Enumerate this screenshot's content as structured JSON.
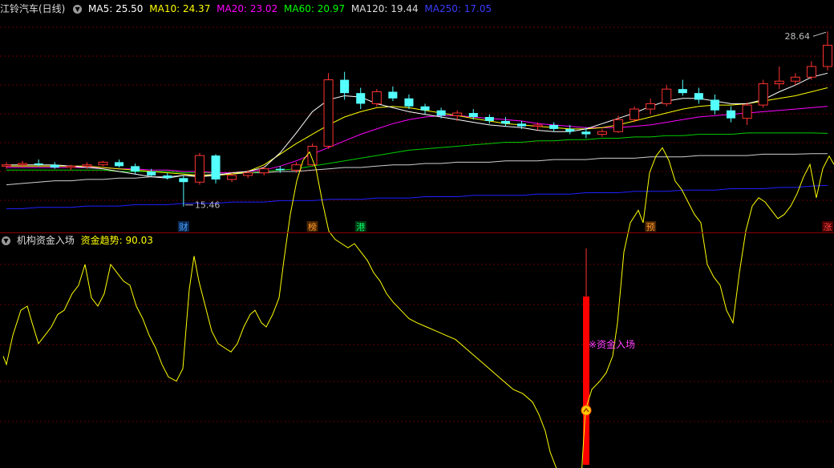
{
  "header": {
    "title": "江铃汽车(日线)",
    "ma": [
      {
        "label": "MA5: 25.50",
        "color": "#ffffff"
      },
      {
        "label": "MA10: 24.37",
        "color": "#ffff00"
      },
      {
        "label": "MA20: 23.02",
        "color": "#ff00ff"
      },
      {
        "label": "MA60: 20.97",
        "color": "#00ff00"
      },
      {
        "label": "MA120: 19.44",
        "color": "#dddddd"
      },
      {
        "label": "MA250: 17.05",
        "color": "#3b3bff"
      }
    ]
  },
  "price_labels": {
    "high": "28.64",
    "low": "15.46"
  },
  "event_markers": [
    {
      "text": "财",
      "color": "#4aa3ff",
      "bg": "#0b2a55",
      "candle": 11
    },
    {
      "text": "榜",
      "color": "#ff9a2e",
      "bg": "#4a2400",
      "candle": 19
    },
    {
      "text": "港",
      "color": "#00ff66",
      "bg": "#003a14",
      "candle": 22
    },
    {
      "text": "预",
      "color": "#ff9a2e",
      "bg": "#4a2400",
      "candle": 40
    },
    {
      "text": "涨",
      "color": "#ff4444",
      "bg": "#4a0000",
      "candle": 51
    }
  ],
  "indicator": {
    "title": "机构资金入场",
    "trend_label": "资金趋势:",
    "trend_value": "90.03",
    "signal_text": "※资金入场"
  },
  "chart_data": {
    "type": "candlestick",
    "y_range": [
      14.6,
      29.8
    ],
    "candles": [
      [
        18.5,
        18.8,
        18.3,
        18.6
      ],
      [
        18.6,
        18.9,
        18.4,
        18.7
      ],
      [
        18.7,
        19.0,
        18.5,
        18.6
      ],
      [
        18.6,
        18.8,
        18.3,
        18.4
      ],
      [
        18.4,
        18.6,
        18.2,
        18.5
      ],
      [
        18.5,
        18.8,
        18.3,
        18.6
      ],
      [
        18.6,
        18.9,
        18.5,
        18.8
      ],
      [
        18.8,
        19.0,
        18.4,
        18.5
      ],
      [
        18.5,
        18.7,
        17.9,
        18.1
      ],
      [
        18.1,
        18.3,
        17.7,
        17.8
      ],
      [
        17.8,
        18.0,
        17.5,
        17.6
      ],
      [
        17.6,
        17.8,
        15.46,
        17.3
      ],
      [
        17.3,
        19.5,
        17.1,
        19.3
      ],
      [
        19.3,
        19.4,
        17.2,
        17.5
      ],
      [
        17.5,
        18.0,
        17.3,
        17.8
      ],
      [
        17.8,
        18.2,
        17.6,
        18.0
      ],
      [
        18.0,
        18.5,
        17.8,
        18.3
      ],
      [
        18.3,
        18.5,
        18.0,
        18.2
      ],
      [
        18.2,
        18.8,
        18.0,
        18.6
      ],
      [
        18.6,
        20.2,
        18.5,
        20.0
      ],
      [
        20.0,
        25.5,
        19.8,
        25.0
      ],
      [
        25.0,
        25.6,
        23.5,
        24.0
      ],
      [
        24.0,
        24.4,
        22.8,
        23.2
      ],
      [
        23.2,
        24.3,
        23.0,
        24.1
      ],
      [
        24.1,
        24.5,
        23.4,
        23.6
      ],
      [
        23.6,
        23.9,
        22.8,
        23.0
      ],
      [
        23.0,
        23.2,
        22.4,
        22.7
      ],
      [
        22.7,
        22.9,
        22.1,
        22.3
      ],
      [
        22.3,
        22.7,
        21.9,
        22.5
      ],
      [
        22.5,
        22.8,
        22.0,
        22.2
      ],
      [
        22.2,
        22.4,
        21.7,
        21.9
      ],
      [
        21.9,
        22.2,
        21.5,
        21.7
      ],
      [
        21.7,
        21.9,
        21.3,
        21.5
      ],
      [
        21.5,
        21.8,
        21.2,
        21.6
      ],
      [
        21.6,
        21.8,
        21.1,
        21.3
      ],
      [
        21.3,
        21.6,
        20.9,
        21.1
      ],
      [
        21.1,
        21.4,
        20.6,
        20.9
      ],
      [
        20.9,
        21.3,
        20.7,
        21.1
      ],
      [
        21.1,
        22.3,
        21.0,
        22.0
      ],
      [
        22.0,
        23.0,
        21.8,
        22.8
      ],
      [
        22.8,
        23.6,
        22.4,
        23.2
      ],
      [
        23.2,
        24.6,
        23.0,
        24.3
      ],
      [
        24.3,
        25.0,
        23.8,
        24.0
      ],
      [
        24.0,
        24.4,
        23.2,
        23.5
      ],
      [
        23.5,
        23.9,
        22.4,
        22.7
      ],
      [
        22.7,
        23.0,
        21.8,
        22.1
      ],
      [
        22.1,
        23.3,
        21.6,
        23.1
      ],
      [
        23.1,
        25.0,
        22.9,
        24.7
      ],
      [
        24.7,
        26.0,
        24.3,
        24.9
      ],
      [
        24.9,
        25.5,
        24.6,
        25.2
      ],
      [
        25.2,
        26.4,
        25.0,
        26.0
      ],
      [
        26.0,
        28.64,
        25.7,
        27.6
      ]
    ],
    "ma5": [
      18.6,
      18.6,
      18.6,
      18.6,
      18.5,
      18.4,
      18.3,
      18.1,
      17.9,
      17.7,
      17.6,
      17.8,
      17.7,
      17.8,
      18.0,
      18.1,
      18.4,
      19.5,
      21.0,
      22.6,
      23.5,
      23.8,
      23.7,
      23.2,
      22.9,
      22.6,
      22.4,
      22.2,
      22.0,
      21.8,
      21.6,
      21.5,
      21.4,
      21.2,
      21.1,
      21.1,
      21.3,
      21.7,
      22.1,
      22.5,
      23.0,
      23.4,
      23.6,
      23.6,
      23.4,
      23.2,
      23.2,
      23.5,
      24.1,
      24.6,
      25.2,
      25.5
    ],
    "ma10": [
      18.5,
      18.5,
      18.5,
      18.5,
      18.5,
      18.5,
      18.4,
      18.3,
      18.2,
      18.1,
      18.0,
      17.9,
      17.8,
      17.8,
      17.9,
      18.1,
      18.6,
      19.4,
      20.2,
      20.9,
      21.6,
      22.2,
      22.6,
      22.9,
      23.0,
      22.9,
      22.7,
      22.5,
      22.3,
      22.1,
      21.9,
      21.7,
      21.6,
      21.5,
      21.4,
      21.3,
      21.3,
      21.4,
      21.6,
      21.9,
      22.2,
      22.5,
      22.8,
      23.0,
      23.1,
      23.1,
      23.2,
      23.4,
      23.6,
      23.8,
      24.1,
      24.4
    ],
    "ma20": [
      18.4,
      18.4,
      18.4,
      18.4,
      18.4,
      18.4,
      18.4,
      18.3,
      18.3,
      18.2,
      18.2,
      18.1,
      18.1,
      18.0,
      18.0,
      18.1,
      18.2,
      18.5,
      18.9,
      19.4,
      19.9,
      20.4,
      20.9,
      21.3,
      21.7,
      22.0,
      22.2,
      22.3,
      22.3,
      22.2,
      22.1,
      22.0,
      21.9,
      21.7,
      21.6,
      21.5,
      21.4,
      21.4,
      21.4,
      21.5,
      21.6,
      21.8,
      22.0,
      22.2,
      22.3,
      22.4,
      22.5,
      22.6,
      22.7,
      22.8,
      22.9,
      23.0
    ],
    "ma60": [
      18.2,
      18.2,
      18.2,
      18.2,
      18.2,
      18.2,
      18.2,
      18.1,
      18.1,
      18.1,
      18.1,
      18.0,
      18.0,
      18.0,
      18.0,
      18.0,
      18.1,
      18.2,
      18.3,
      18.5,
      18.7,
      18.9,
      19.1,
      19.3,
      19.5,
      19.7,
      19.8,
      19.9,
      20.0,
      20.1,
      20.2,
      20.3,
      20.3,
      20.4,
      20.4,
      20.5,
      20.5,
      20.6,
      20.6,
      20.7,
      20.7,
      20.8,
      20.8,
      20.9,
      20.9,
      20.9,
      21.0,
      21.0,
      21.0,
      21.0,
      21.0,
      20.97
    ],
    "ma120": [
      17.1,
      17.2,
      17.3,
      17.4,
      17.4,
      17.5,
      17.5,
      17.6,
      17.6,
      17.7,
      17.7,
      17.8,
      17.8,
      17.9,
      17.9,
      18.0,
      18.0,
      18.1,
      18.1,
      18.2,
      18.3,
      18.4,
      18.4,
      18.5,
      18.6,
      18.6,
      18.7,
      18.7,
      18.8,
      18.8,
      18.8,
      18.9,
      18.9,
      18.9,
      19.0,
      19.0,
      19.0,
      19.1,
      19.1,
      19.1,
      19.2,
      19.2,
      19.2,
      19.3,
      19.3,
      19.3,
      19.3,
      19.4,
      19.4,
      19.4,
      19.44,
      19.44
    ],
    "ma250": [
      15.3,
      15.3,
      15.4,
      15.4,
      15.4,
      15.5,
      15.5,
      15.5,
      15.6,
      15.6,
      15.6,
      15.7,
      15.7,
      15.7,
      15.8,
      15.8,
      15.8,
      15.9,
      15.9,
      15.9,
      16.0,
      16.0,
      16.0,
      16.1,
      16.1,
      16.1,
      16.2,
      16.2,
      16.2,
      16.3,
      16.3,
      16.3,
      16.3,
      16.4,
      16.4,
      16.4,
      16.5,
      16.5,
      16.5,
      16.6,
      16.6,
      16.6,
      16.7,
      16.7,
      16.7,
      16.8,
      16.8,
      16.8,
      16.9,
      16.9,
      17.0,
      17.05
    ],
    "trend_range": [
      0,
      100
    ],
    "trend": [
      [
        4,
        36
      ],
      [
        8,
        32
      ],
      [
        16,
        46
      ],
      [
        26,
        58
      ],
      [
        34,
        60
      ],
      [
        40,
        52
      ],
      [
        48,
        42
      ],
      [
        56,
        46
      ],
      [
        64,
        50
      ],
      [
        72,
        56
      ],
      [
        80,
        58
      ],
      [
        90,
        66
      ],
      [
        98,
        70
      ],
      [
        106,
        80
      ],
      [
        114,
        64
      ],
      [
        122,
        60
      ],
      [
        130,
        66
      ],
      [
        138,
        80
      ],
      [
        146,
        76
      ],
      [
        154,
        72
      ],
      [
        162,
        70
      ],
      [
        170,
        60
      ],
      [
        178,
        54
      ],
      [
        186,
        46
      ],
      [
        194,
        40
      ],
      [
        202,
        32
      ],
      [
        210,
        26
      ],
      [
        220,
        24
      ],
      [
        228,
        30
      ],
      [
        236,
        68
      ],
      [
        242,
        84
      ],
      [
        248,
        72
      ],
      [
        256,
        60
      ],
      [
        264,
        48
      ],
      [
        272,
        42
      ],
      [
        280,
        40
      ],
      [
        288,
        38
      ],
      [
        296,
        42
      ],
      [
        304,
        50
      ],
      [
        312,
        56
      ],
      [
        318,
        58
      ],
      [
        326,
        52
      ],
      [
        332,
        50
      ],
      [
        340,
        56
      ],
      [
        348,
        64
      ],
      [
        354,
        82
      ],
      [
        362,
        104
      ],
      [
        370,
        120
      ],
      [
        378,
        130
      ],
      [
        386,
        134
      ],
      [
        394,
        126
      ],
      [
        402,
        110
      ],
      [
        410,
        96
      ],
      [
        418,
        92
      ],
      [
        426,
        90
      ],
      [
        434,
        88
      ],
      [
        442,
        90
      ],
      [
        450,
        86
      ],
      [
        458,
        82
      ],
      [
        466,
        76
      ],
      [
        474,
        72
      ],
      [
        482,
        66
      ],
      [
        490,
        62
      ],
      [
        500,
        58
      ],
      [
        510,
        54
      ],
      [
        520,
        52
      ],
      [
        532,
        50
      ],
      [
        544,
        48
      ],
      [
        556,
        46
      ],
      [
        568,
        44
      ],
      [
        580,
        40
      ],
      [
        592,
        36
      ],
      [
        604,
        32
      ],
      [
        616,
        28
      ],
      [
        628,
        24
      ],
      [
        640,
        20
      ],
      [
        652,
        18
      ],
      [
        664,
        14
      ],
      [
        672,
        8
      ],
      [
        680,
        0
      ],
      [
        686,
        -10
      ],
      [
        694,
        -18
      ],
      [
        700,
        -22
      ],
      [
        708,
        -24
      ],
      [
        716,
        -26
      ],
      [
        724,
        -28
      ],
      [
        730,
        10
      ],
      [
        738,
        20
      ],
      [
        748,
        24
      ],
      [
        756,
        28
      ],
      [
        764,
        36
      ],
      [
        770,
        52
      ],
      [
        778,
        86
      ],
      [
        786,
        100
      ],
      [
        796,
        106
      ],
      [
        802,
        100
      ],
      [
        810,
        124
      ],
      [
        818,
        132
      ],
      [
        826,
        136
      ],
      [
        834,
        130
      ],
      [
        842,
        120
      ],
      [
        850,
        116
      ],
      [
        858,
        110
      ],
      [
        866,
        104
      ],
      [
        874,
        100
      ],
      [
        882,
        80
      ],
      [
        890,
        74
      ],
      [
        898,
        70
      ],
      [
        906,
        58
      ],
      [
        914,
        52
      ],
      [
        922,
        76
      ],
      [
        930,
        96
      ],
      [
        938,
        108
      ],
      [
        946,
        112
      ],
      [
        954,
        110
      ],
      [
        962,
        106
      ],
      [
        970,
        102
      ],
      [
        978,
        104
      ],
      [
        986,
        108
      ],
      [
        994,
        114
      ],
      [
        1002,
        122
      ],
      [
        1010,
        128
      ],
      [
        1018,
        112
      ],
      [
        1026,
        126
      ],
      [
        1034,
        132
      ],
      [
        1040,
        128
      ]
    ],
    "signal_x": 731,
    "signal_value": 10
  }
}
